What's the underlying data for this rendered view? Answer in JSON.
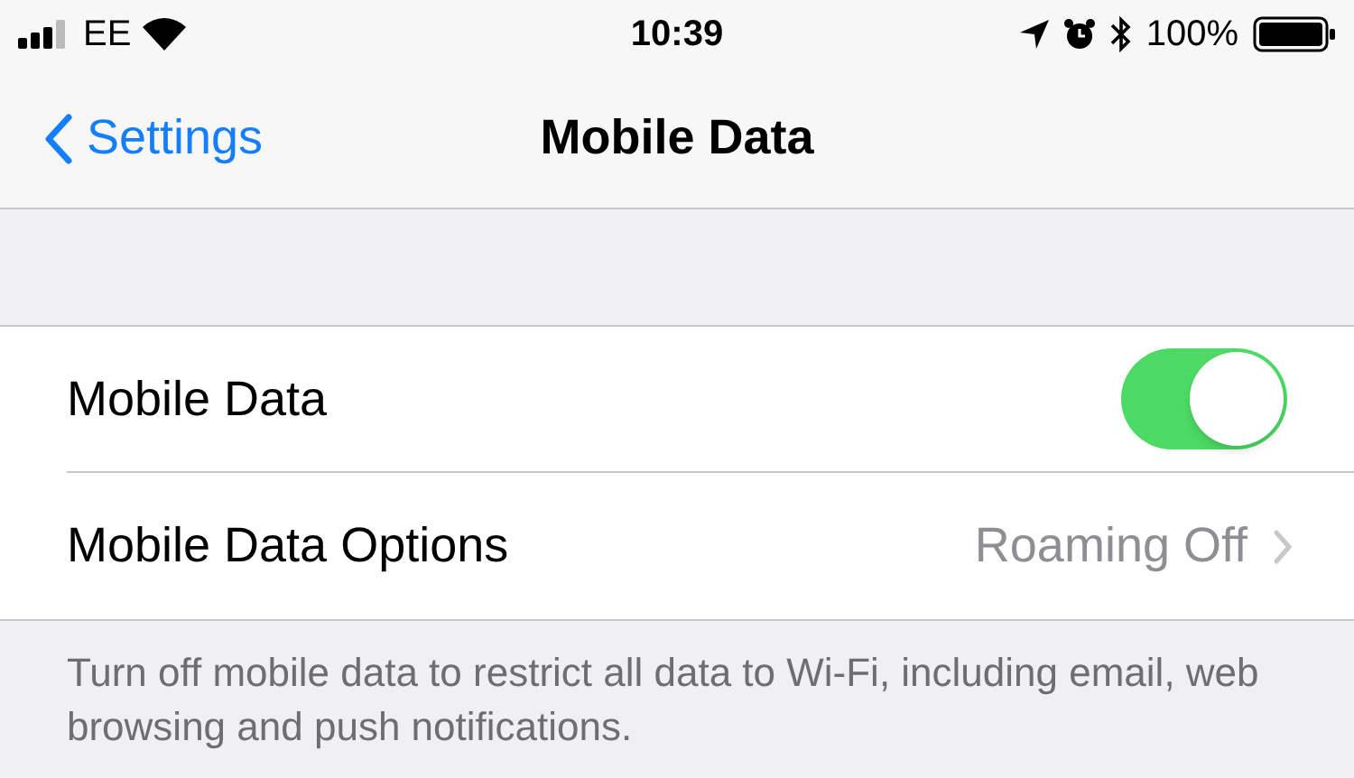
{
  "status_bar": {
    "carrier": "EE",
    "time": "10:39",
    "battery": "100%"
  },
  "nav": {
    "back": "Settings",
    "title": "Mobile Data"
  },
  "rows": [
    {
      "kind": "toggle",
      "label": "Mobile Data",
      "on": true
    },
    {
      "kind": "link",
      "label": "Mobile Data Options",
      "value": "Roaming Off"
    }
  ],
  "footer": "Turn off mobile data to restrict all data to Wi-Fi, including email, web browsing and push notifications."
}
